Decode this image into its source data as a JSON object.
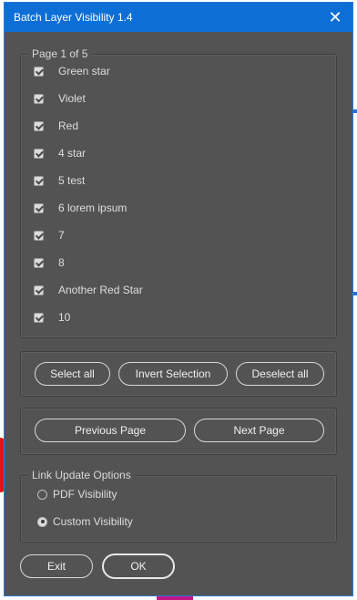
{
  "window": {
    "title": "Batch Layer Visibility 1.4"
  },
  "layers": {
    "group_label": "Page 1 of 5",
    "items": [
      {
        "label": "Green star",
        "checked": true
      },
      {
        "label": "Violet",
        "checked": true
      },
      {
        "label": "Red",
        "checked": true
      },
      {
        "label": "4 star",
        "checked": true
      },
      {
        "label": "5 test",
        "checked": true
      },
      {
        "label": "6 lorem ipsum",
        "checked": true
      },
      {
        "label": "7",
        "checked": true
      },
      {
        "label": "8",
        "checked": true
      },
      {
        "label": "Another Red Star",
        "checked": true
      },
      {
        "label": "10",
        "checked": true
      }
    ]
  },
  "selection": {
    "select_all": "Select all",
    "invert": "Invert Selection",
    "deselect_all": "Deselect all"
  },
  "paging": {
    "previous": "Previous Page",
    "next": "Next Page"
  },
  "link_options": {
    "group_label": "Link Update Options",
    "options": [
      {
        "label": "PDF Visibility",
        "selected": false
      },
      {
        "label": "Custom Visibility",
        "selected": true
      }
    ]
  },
  "footer": {
    "exit": "Exit",
    "ok": "OK"
  },
  "colors": {
    "titlebar": "#0d6fd6",
    "panel": "#535353"
  }
}
